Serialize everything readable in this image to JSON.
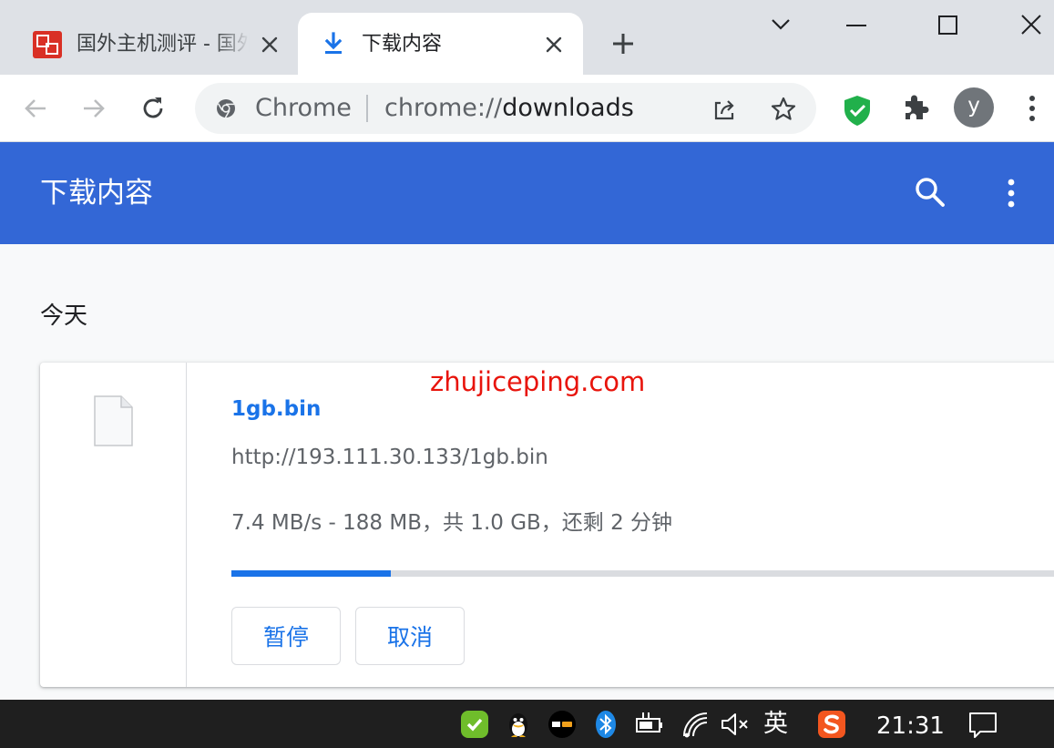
{
  "tabs": [
    {
      "title": "国外主机测评 - 国外VPS，国外服务器",
      "active": false,
      "favicon": "site-logo-icon"
    },
    {
      "title": "下载内容",
      "active": true,
      "favicon": "download-icon"
    }
  ],
  "toolbar": {
    "omnibox_chip": "Chrome",
    "url_scheme": "chrome://",
    "url_host": "downloads",
    "avatar_letter": "y"
  },
  "downloads_page": {
    "title": "下载内容",
    "section_date": "今天",
    "items": [
      {
        "file_name": "1gb.bin",
        "url": "http://193.111.30.133/1gb.bin",
        "status": "7.4 MB/s - 188 MB，共 1.0 GB，还剩 2 分钟",
        "progress_fraction": 0.19,
        "pause_label": "暂停",
        "cancel_label": "取消"
      }
    ]
  },
  "watermark": "zhujiceping.com",
  "taskbar": {
    "ime": "英",
    "clock": "21:31"
  },
  "colors": {
    "header_blue": "#3367d6",
    "accent_blue": "#1a73e8",
    "watermark_red": "#e8140c",
    "taskbar": "#1f1f1f"
  }
}
